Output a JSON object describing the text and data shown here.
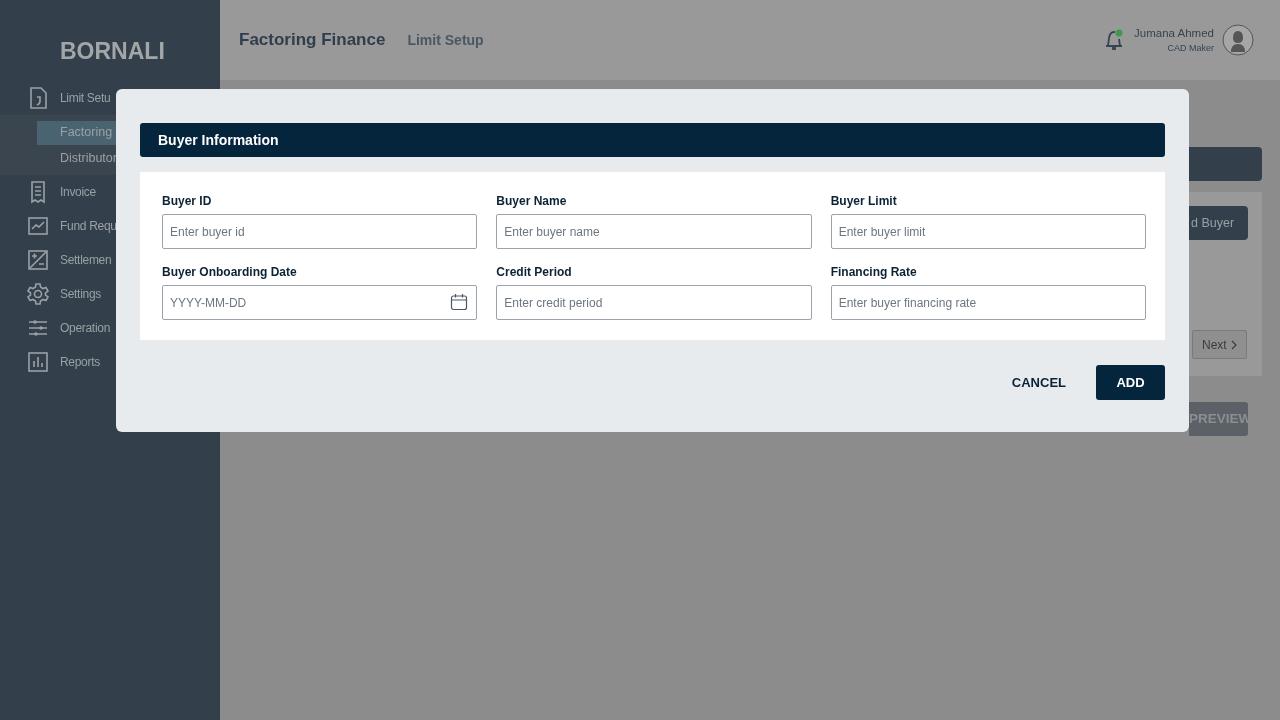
{
  "brand": "BORNALI",
  "sidebar": {
    "items": [
      {
        "label": "Limit Setu",
        "children": [
          {
            "label": "Factoring",
            "selected": true
          },
          {
            "label": "Distributor",
            "selected": false
          }
        ]
      },
      {
        "label": "Invoice"
      },
      {
        "label": "Fund Requ"
      },
      {
        "label": "Settlemen"
      },
      {
        "label": "Settings"
      },
      {
        "label": "Operation"
      },
      {
        "label": "Reports"
      }
    ]
  },
  "header": {
    "title": "Factoring Finance",
    "subtitle": "Limit Setup",
    "user": {
      "name": "Jumana Ahmed",
      "role": "CAD Maker"
    }
  },
  "background": {
    "add_button": "d Buyer",
    "next_button": "Next",
    "preview_button": "PREVIEW"
  },
  "modal": {
    "title": "Buyer Information",
    "fields": [
      {
        "label": "Buyer ID",
        "placeholder": "Enter buyer id",
        "kind": "text"
      },
      {
        "label": "Buyer Name",
        "placeholder": "Enter buyer name",
        "kind": "text"
      },
      {
        "label": "Buyer Limit",
        "placeholder": "Enter buyer limit",
        "kind": "text"
      },
      {
        "label": "Buyer Onboarding Date",
        "placeholder": "YYYY-MM-DD",
        "kind": "date"
      },
      {
        "label": "Credit Period",
        "placeholder": "Enter credit period",
        "kind": "text"
      },
      {
        "label": "Financing Rate",
        "placeholder": "Enter buyer financing rate",
        "kind": "text"
      }
    ],
    "buttons": [
      {
        "label": "CANCEL",
        "kind": "text"
      },
      {
        "label": "ADD",
        "kind": "primary"
      }
    ]
  }
}
